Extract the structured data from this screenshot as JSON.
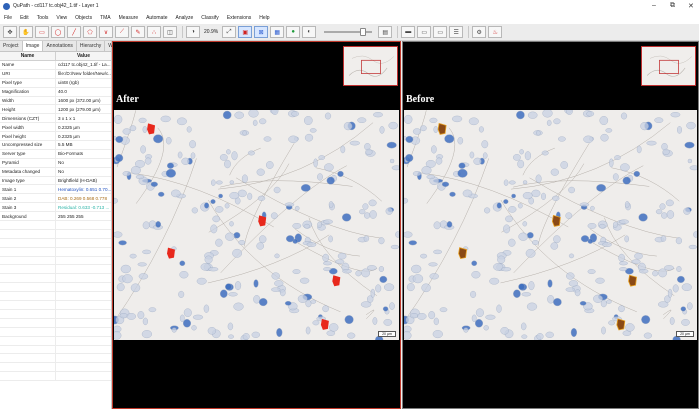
{
  "window": {
    "title": "QuPath - cd117 tc.obj42_1.tif - Layer 1",
    "controls": [
      "–",
      "⧉",
      "✕"
    ]
  },
  "menu": {
    "items": [
      "File",
      "Edit",
      "Tools",
      "View",
      "Objects",
      "TMA",
      "Measure",
      "Automate",
      "Analyze",
      "Classify",
      "Extensions",
      "Help"
    ]
  },
  "toolbar": {
    "zoom_label": "20.9%"
  },
  "left_panel": {
    "tabs": [
      "Project",
      "Image",
      "Annotations",
      "Hierarchy",
      "Workf"
    ],
    "selected_tab": 1,
    "columns": [
      "Name",
      "Value"
    ],
    "rows": [
      {
        "k": "Name",
        "v": "cd117 tc.obj42_1.tif - La..."
      },
      {
        "k": "URI",
        "v": "file:/D:/New folder/New/c..."
      },
      {
        "k": "Pixel type",
        "v": "uint8 (rgb)"
      },
      {
        "k": "Magnification",
        "v": "40.0"
      },
      {
        "k": "Width",
        "v": "1600 px (372.00 µm)"
      },
      {
        "k": "Height",
        "v": "1200 px (279.00 µm)"
      },
      {
        "k": "Dimensions (CZT)",
        "v": "3 x 1 x 1"
      },
      {
        "k": "Pixel width",
        "v": "0.2325 µm"
      },
      {
        "k": "Pixel height",
        "v": "0.2325 µm"
      },
      {
        "k": "Uncompressed size",
        "v": "5.5 MB"
      },
      {
        "k": "Server type",
        "v": "Bio-Formats"
      },
      {
        "k": "Pyramid",
        "v": "No"
      },
      {
        "k": "Metadata changed",
        "v": "No"
      },
      {
        "k": "Image type",
        "v": "Brightfield (H-DAB)"
      },
      {
        "k": "Stain 1",
        "v": "Hematoxylin: 0.651 0.70..."
      },
      {
        "k": "Stain 2",
        "v": "DAB: 0.269 0.568 0.778"
      },
      {
        "k": "Stain 3",
        "v": "Residual: 0.633 -0.713 ..."
      },
      {
        "k": "Background",
        "v": "255 255 255"
      }
    ],
    "stain_colors": {
      "stain1": "#1f4fbf",
      "stain2": "#a86a12",
      "stain3": "#2bb3a6"
    }
  },
  "viewers": {
    "left_label": "After",
    "right_label": "Before",
    "scale_text": "20 µm"
  },
  "colors": {
    "after_highlight": "#e8281c",
    "before_highlight": "#8a4a16",
    "border_active": "#c0392b"
  }
}
